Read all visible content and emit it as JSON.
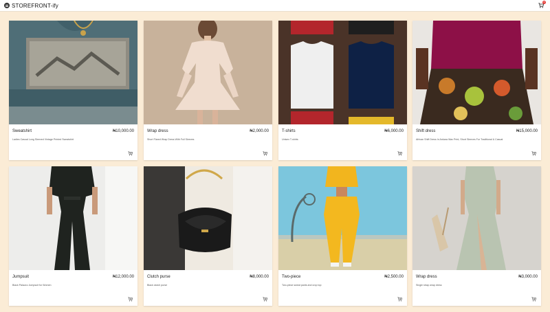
{
  "appbar": {
    "brand": "STOREFRONT-ify",
    "cart_count": "8"
  },
  "products": [
    {
      "name": "Sweatshirt",
      "price": "₦10,000.00",
      "description": "Ladies Casual Long Sleeved Vintage Printed Sweatshirt"
    },
    {
      "name": "Wrap dress",
      "price": "₦2,000.00",
      "description": "Short Flared Wrap Dress With Full Sleeves"
    },
    {
      "name": "T-shirts",
      "price": "₦6,000.00",
      "description": "Unisex T-shirts"
    },
    {
      "name": "Shift dress",
      "price": "₦15,000.00",
      "description": "African Shift Dress In Ankara Wax Print, Short Sleeves For Traditional & Casual"
    },
    {
      "name": "Jumpsuit",
      "price": "₦12,000.00",
      "description": "Black Palazzo Jumpsuit for Women"
    },
    {
      "name": "Clutch purse",
      "price": "₦8,000.00",
      "description": "Black clutch purse"
    },
    {
      "name": "Two-piece",
      "price": "₦2,500.00",
      "description": "Two-piece sweat pants and crop top"
    },
    {
      "name": "Wrap dress",
      "price": "₦3,000.00",
      "description": "Single strap wrap dress"
    }
  ]
}
